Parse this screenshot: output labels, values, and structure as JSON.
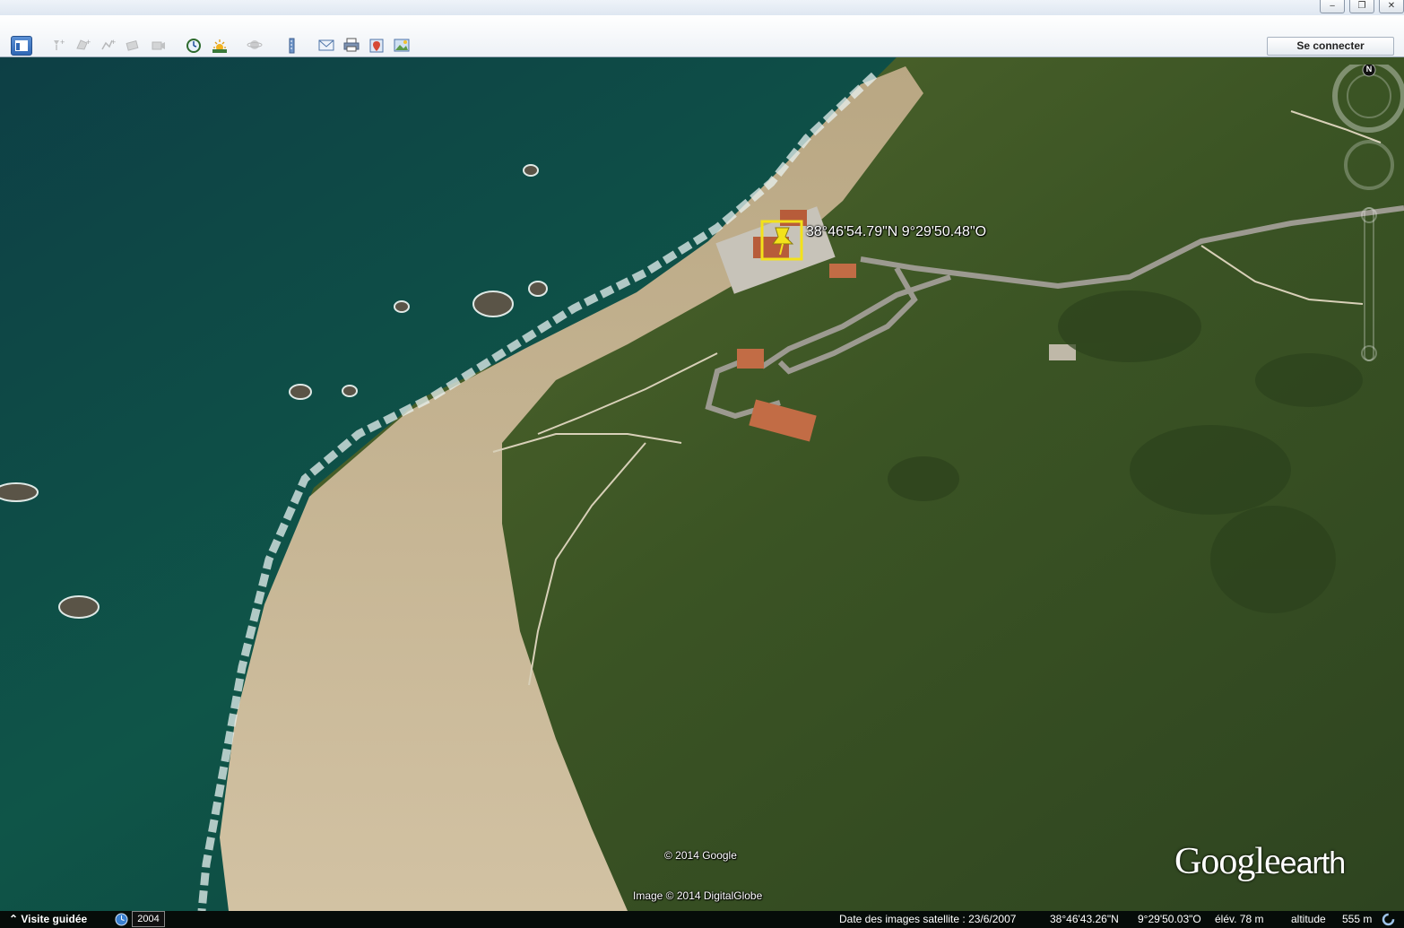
{
  "window": {
    "buttons": [
      "‒",
      "❐",
      "✕"
    ]
  },
  "toolbar": {
    "sign_in_label": "Se connecter",
    "buttons": [
      {
        "name": "sidebar-toggle-button",
        "icon": "sidebar-icon",
        "active": true
      },
      {
        "name": "add-placemark-button",
        "icon": "placemark-icon"
      },
      {
        "name": "add-polygon-button",
        "icon": "polygon-icon"
      },
      {
        "name": "add-path-button",
        "icon": "path-icon"
      },
      {
        "name": "add-image-overlay-button",
        "icon": "image-overlay-icon"
      },
      {
        "name": "record-tour-button",
        "icon": "record-tour-icon"
      },
      {
        "name": "historical-imagery-button",
        "icon": "clock-icon"
      },
      {
        "name": "sunlight-button",
        "icon": "sun-icon"
      },
      {
        "name": "switch-planet-button",
        "icon": "planet-icon"
      },
      {
        "name": "ruler-button",
        "icon": "ruler-icon"
      },
      {
        "name": "email-button",
        "icon": "email-icon"
      },
      {
        "name": "print-button",
        "icon": "print-icon"
      },
      {
        "name": "view-in-maps-button",
        "icon": "maps-icon"
      },
      {
        "name": "save-image-button",
        "icon": "save-image-icon"
      }
    ]
  },
  "map": {
    "placemark_coordinates": "38°46'54.79\"N   9°29'50.48\"O",
    "copyright_google": "© 2014 Google",
    "copyright_imagery": "Image © 2014 DigitalGlobe",
    "brand_main": "Google",
    "brand_sub": "earth",
    "compass_north": "N"
  },
  "status": {
    "tour_label": "Visite guidée",
    "year": "2004",
    "imagery_date": "Date des images satellite : 23/6/2007",
    "latitude": "38°46'43.26\"N",
    "longitude": "9°29'50.03\"O",
    "elevation": "élév.   78 m",
    "altitude_label": "altitude",
    "altitude_value": "555 m"
  },
  "colors": {
    "sea": "#0f4a40",
    "land": "#3b5424",
    "rock": "#c8b695",
    "placemark": "#f3e21a"
  }
}
